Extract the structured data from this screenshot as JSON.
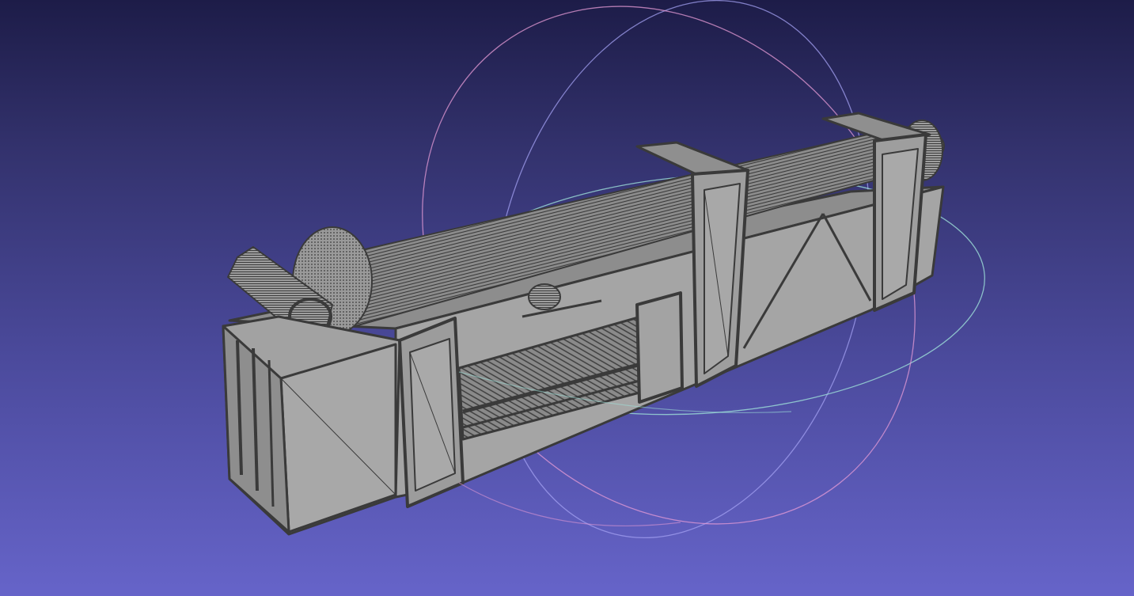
{
  "viewer": {
    "background_top": "#1d1c48",
    "background_bottom": "#6664c9",
    "mesh_face_color": "#a3a3a3",
    "mesh_edge_color": "#3a3a3a",
    "trackball_x_color": "#e69bd6",
    "trackball_y_color": "#9ee0d8",
    "trackball_z_color": "#a3a0f2"
  },
  "icons": {
    "trackball": "trackball-gizmo-icon"
  }
}
